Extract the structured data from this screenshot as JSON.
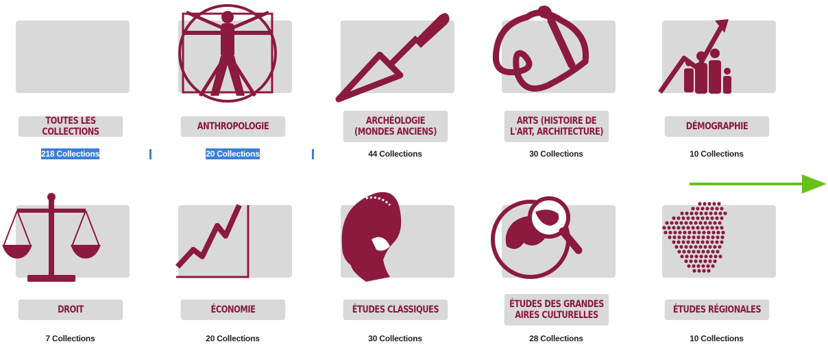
{
  "colors": {
    "accent": "#8b1a3e",
    "card_bg": "#d9d9d9",
    "selection": "#3a7fd6",
    "arrow": "#66c21a"
  },
  "collections": [
    {
      "label": "TOUTES LES COLLECTIONS",
      "count": "218 Collections",
      "icon": "none",
      "selected": true
    },
    {
      "label": "ANTHROPOLOGIE",
      "count": "20 Collections",
      "icon": "vitruvian-man-icon",
      "selected": true
    },
    {
      "label": "ARCHÉOLOGIE (MONDES ANCIENS)",
      "count": "44 Collections",
      "icon": "trowel-icon",
      "selected": false
    },
    {
      "label": "ARTS (HISTOIRE DE L'ART, ARCHITECTURE)",
      "count": "30 Collections",
      "icon": "paintbrush-icon",
      "selected": false
    },
    {
      "label": "DÉMOGRAPHIE",
      "count": "10 Collections",
      "icon": "population-growth-icon",
      "selected": false
    },
    {
      "label": "DROIT",
      "count": "7 Collections",
      "icon": "scales-icon",
      "selected": false
    },
    {
      "label": "ÉCONOMIE",
      "count": "20 Collections",
      "icon": "line-chart-icon",
      "selected": false
    },
    {
      "label": "ÉTUDES CLASSIQUES",
      "count": "30 Collections",
      "icon": "spartan-helmet-icon",
      "selected": false
    },
    {
      "label": "ÉTUDES DES GRANDES AIRES CULTURELLES",
      "count": "28 Collections",
      "icon": "globe-magnifier-icon",
      "selected": false
    },
    {
      "label": "ÉTUDES RÉGIONALES",
      "count": "10 Collections",
      "icon": "france-map-dots-icon",
      "selected": false
    }
  ],
  "navigation": {
    "next_icon": "arrow-right-icon"
  }
}
